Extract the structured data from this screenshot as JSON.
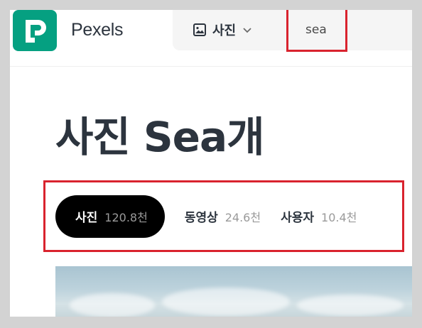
{
  "header": {
    "brand": "Pexels",
    "logo_icon": "pexels-logo-icon",
    "search": {
      "type_label": "사진",
      "type_icon": "image-icon",
      "dropdown_icon": "chevron-down-icon",
      "query": "sea"
    }
  },
  "main": {
    "title": "사진 Sea개",
    "tabs": [
      {
        "label": "사진",
        "count": "120.8천",
        "active": true
      },
      {
        "label": "동영상",
        "count": "24.6천",
        "active": false
      },
      {
        "label": "사용자",
        "count": "10.4천",
        "active": false
      }
    ]
  },
  "colors": {
    "brand": "#05a081",
    "text": "#2c343e",
    "highlight": "#d9232e",
    "active_tab_bg": "#000000"
  }
}
